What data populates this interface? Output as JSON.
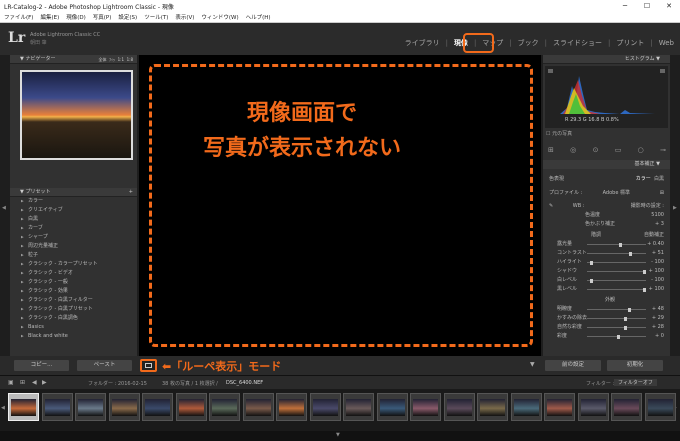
{
  "window": {
    "title": "LR-Catalog-2 - Adobe Photoshop Lightroom Classic - 現像",
    "controls": [
      "─",
      "☐",
      "✕"
    ]
  },
  "menu": [
    "ファイル(F)",
    "編集(E)",
    "現像(D)",
    "写真(P)",
    "設定(S)",
    "ツール(T)",
    "表示(V)",
    "ウィンドウ(W)",
    "ヘルプ(H)"
  ],
  "identity": {
    "logo": "Lr",
    "app_name": "Adobe Lightroom Classic CC",
    "user": "朝田 肇"
  },
  "modules": {
    "library": "ライブラリ",
    "develop": "現像",
    "map": "マップ",
    "book": "ブック",
    "slideshow": "スライドショー",
    "print": "プリント",
    "web": "Web"
  },
  "left_panel": {
    "navigator_title": "ナビゲーター",
    "navigator_zoom": [
      "全体",
      "ﾌｨｯ",
      "1:1",
      "1:8"
    ],
    "presets_title": "プリセット",
    "presets": [
      "カラー",
      "クリエイティブ",
      "白黒",
      "カーブ",
      "シャープ",
      "周辺光量補正",
      "粒子",
      "クラシック - カラープリセット",
      "クラシック - ビデオ",
      "クラシック - 一般",
      "クラシック - 効果",
      "クラシック - 白黒フィルター",
      "クラシック - 白黒プリセット",
      "クラシック - 白黒調色",
      "Basics",
      "Black and white"
    ]
  },
  "annotation": {
    "line1": "現像画面で",
    "line2": "写真が表示されない",
    "loupe_note": "「ルーペ表示」モード"
  },
  "right_panel": {
    "histogram_title": "ヒストグラム",
    "rgb_readout": "R  29.3  G  16.8  B  0.8%",
    "original_photo": "元の写真",
    "basic_title": "基本補正",
    "treatment_label": "色表現",
    "treatment_color": "カラー",
    "treatment_bw": "白黒",
    "profile_label": "プロファイル :",
    "profile_value": "Adobe 標準",
    "wb_label": "WB :",
    "wb_value": "撮影時の設定 :",
    "temp_label": "色温度",
    "temp_value": "5100",
    "tint_label": "色かぶり補正",
    "tint_value": "+ 3",
    "tone_label": "階調",
    "tone_auto": "自動補正",
    "sliders": [
      {
        "label": "露光量",
        "value": "+ 0.40",
        "pos": 0.55
      },
      {
        "label": "コントラスト",
        "value": "+ 51",
        "pos": 0.72
      },
      {
        "label": "ハイライト",
        "value": "- 100",
        "pos": 0.05
      },
      {
        "label": "シャドウ",
        "value": "+ 100",
        "pos": 0.95
      },
      {
        "label": "白レベル",
        "value": "- 100",
        "pos": 0.05
      },
      {
        "label": "黒レベル",
        "value": "+ 100",
        "pos": 0.95
      }
    ],
    "presence_label": "外観",
    "presence": [
      {
        "label": "明瞭度",
        "value": "+ 48",
        "pos": 0.7
      },
      {
        "label": "かすみの除去",
        "value": "+ 29",
        "pos": 0.62
      },
      {
        "label": "自然な彩度",
        "value": "+ 28",
        "pos": 0.62
      },
      {
        "label": "彩度",
        "value": "+ 0",
        "pos": 0.5
      }
    ],
    "prev_button": "前の設定",
    "reset_button": "初期化"
  },
  "toolbar": {
    "copy": "コピー...",
    "paste": "ペースト"
  },
  "filmbar": {
    "folder": "フォルダー : 2016-02-15",
    "count": "38 枚の写真 / 1 枚選択 /",
    "filename": "DSC_6400.NEF",
    "filter_label": "フィルター :",
    "filter_value": "フィルターオフ"
  },
  "thumbnails": [
    "#c66a3a",
    "#4a5a7a",
    "#6a7a8a",
    "#8a6a4a",
    "#3a4a6a",
    "#b05a3a",
    "#5a6a5a",
    "#7a5a4a",
    "#c0703a",
    "#4a4a6a",
    "#6a5a5a",
    "#3a5a7a",
    "#8a5a6a",
    "#5a4a5a",
    "#7a6a4a",
    "#4a6a7a",
    "#a05a4a",
    "#5a5a6a",
    "#6a4a5a",
    "#3a4a5a"
  ],
  "colors": {
    "accent": "#f26a1b"
  }
}
